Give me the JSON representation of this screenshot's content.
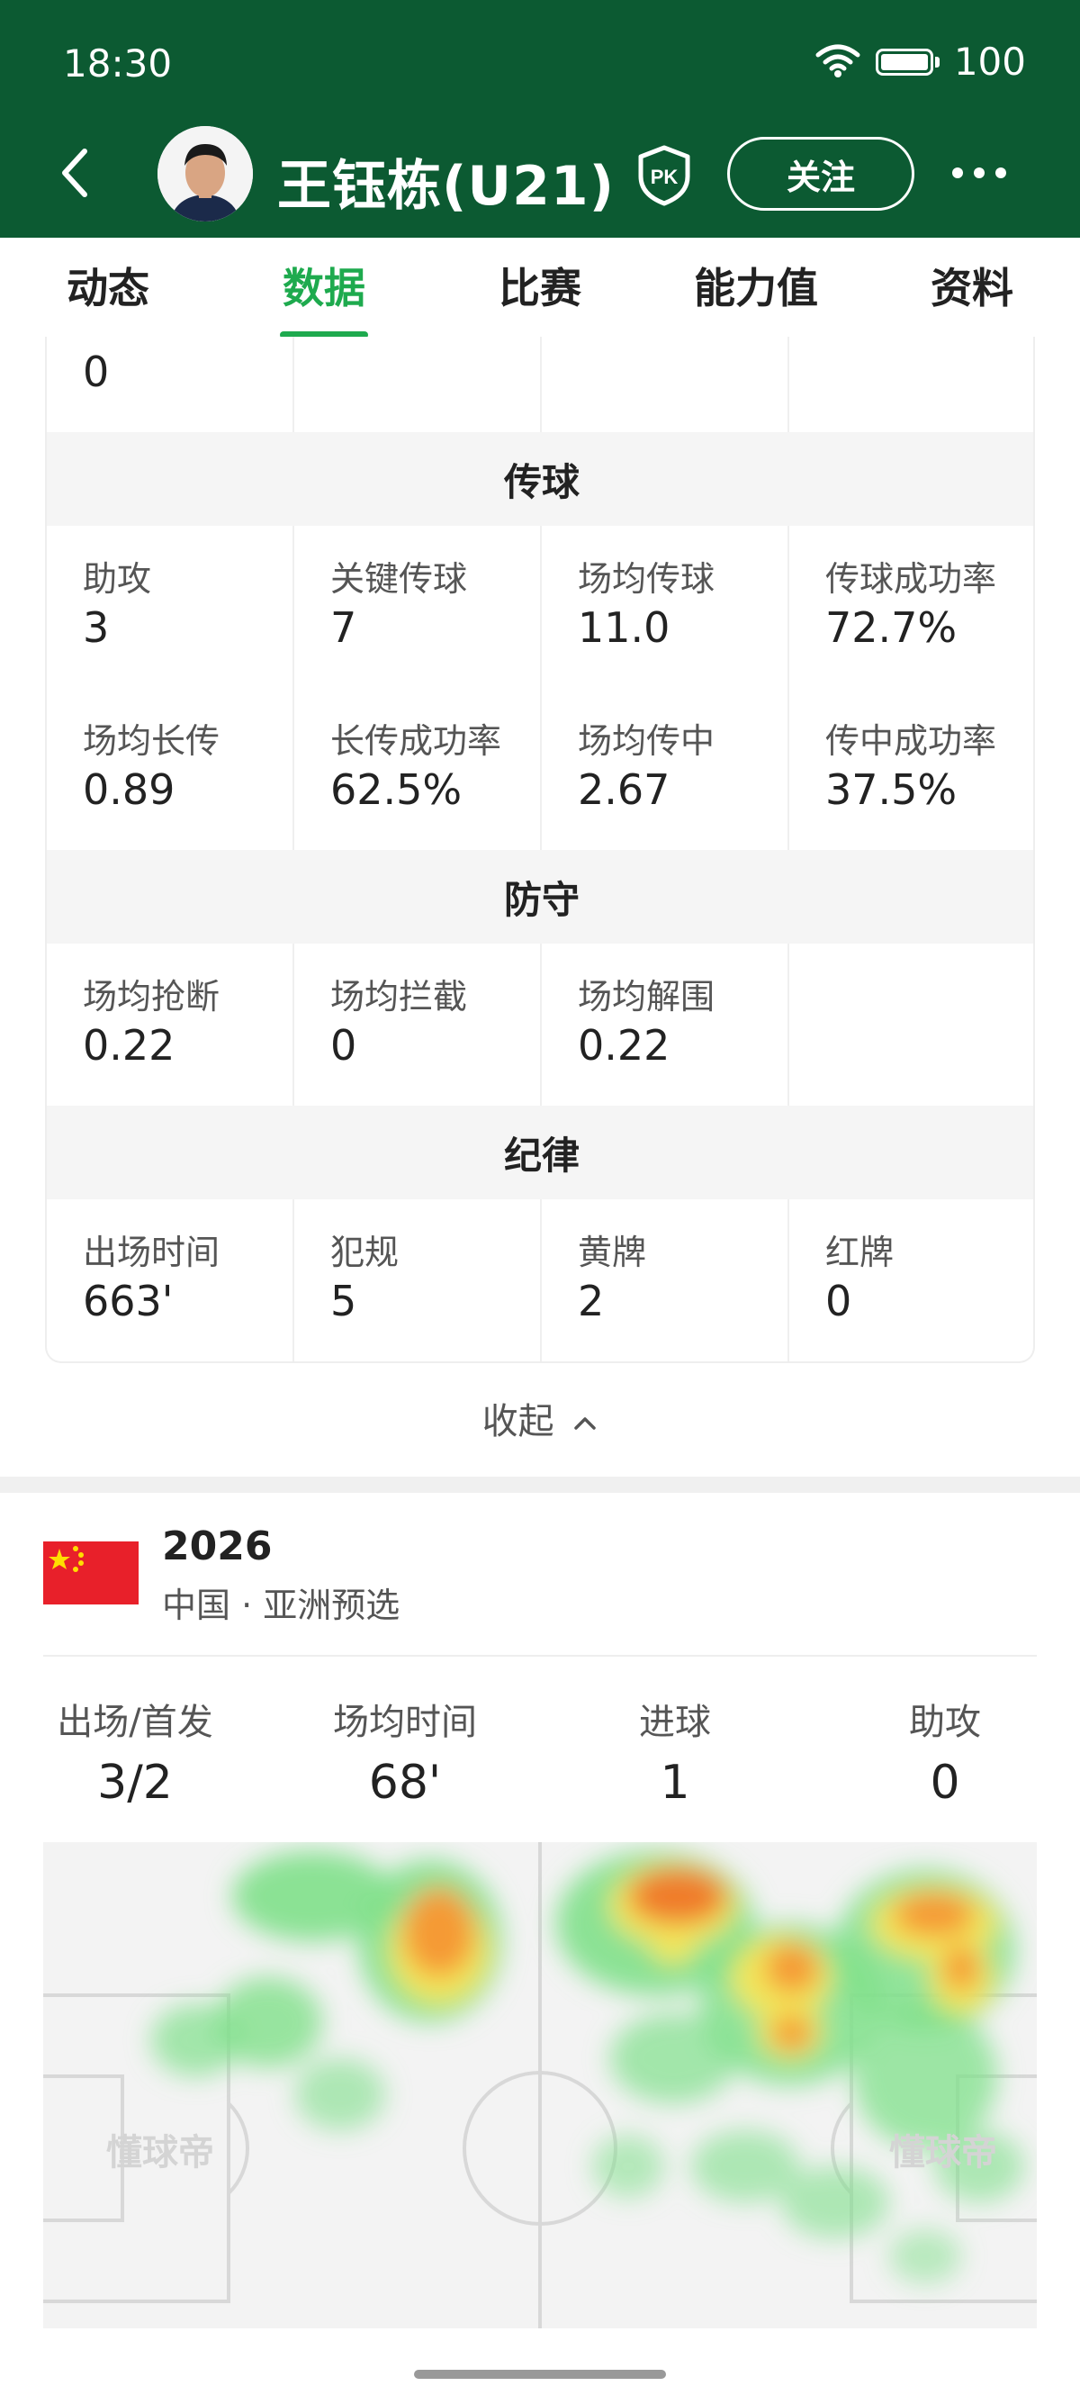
{
  "status_bar": {
    "time": "18:30",
    "battery": "100"
  },
  "header": {
    "player_name": "王钰栋(U21)",
    "pk_label": "PK",
    "follow_label": "关注"
  },
  "tabs": [
    {
      "label": "动态",
      "active": false
    },
    {
      "label": "数据",
      "active": true
    },
    {
      "label": "比赛",
      "active": false
    },
    {
      "label": "能力值",
      "active": false
    },
    {
      "label": "资料",
      "active": false
    }
  ],
  "stats": {
    "top_row": {
      "value": "0"
    },
    "passing": {
      "title": "传球",
      "rows": [
        [
          {
            "label": "助攻",
            "value": "3"
          },
          {
            "label": "关键传球",
            "value": "7"
          },
          {
            "label": "场均传球",
            "value": "11.0"
          },
          {
            "label": "传球成功率",
            "value": "72.7%"
          }
        ],
        [
          {
            "label": "场均长传",
            "value": "0.89"
          },
          {
            "label": "长传成功率",
            "value": "62.5%"
          },
          {
            "label": "场均传中",
            "value": "2.67"
          },
          {
            "label": "传中成功率",
            "value": "37.5%"
          }
        ]
      ]
    },
    "defense": {
      "title": "防守",
      "rows": [
        [
          {
            "label": "场均抢断",
            "value": "0.22"
          },
          {
            "label": "场均拦截",
            "value": "0"
          },
          {
            "label": "场均解围",
            "value": "0.22"
          },
          {
            "label": "",
            "value": ""
          }
        ]
      ]
    },
    "discipline": {
      "title": "纪律",
      "rows": [
        [
          {
            "label": "出场时间",
            "value": "663'"
          },
          {
            "label": "犯规",
            "value": "5"
          },
          {
            "label": "黄牌",
            "value": "2"
          },
          {
            "label": "红牌",
            "value": "0"
          }
        ]
      ]
    }
  },
  "collapse_label": "收起",
  "competition": {
    "year": "2026",
    "subtitle": "中国 · 亚洲预选",
    "flag_colors": {
      "field": "#e8202a",
      "stars": "#ffde00"
    },
    "summary": [
      {
        "label": "出场/首发",
        "value": "3/2"
      },
      {
        "label": "场均时间",
        "value": "68'"
      },
      {
        "label": "进球",
        "value": "1"
      },
      {
        "label": "助攻",
        "value": "0"
      }
    ]
  },
  "heatmap": {
    "watermark": "懂球帝"
  },
  "colors": {
    "header_bg": "#0c5a32",
    "accent": "#1eaa4e"
  }
}
